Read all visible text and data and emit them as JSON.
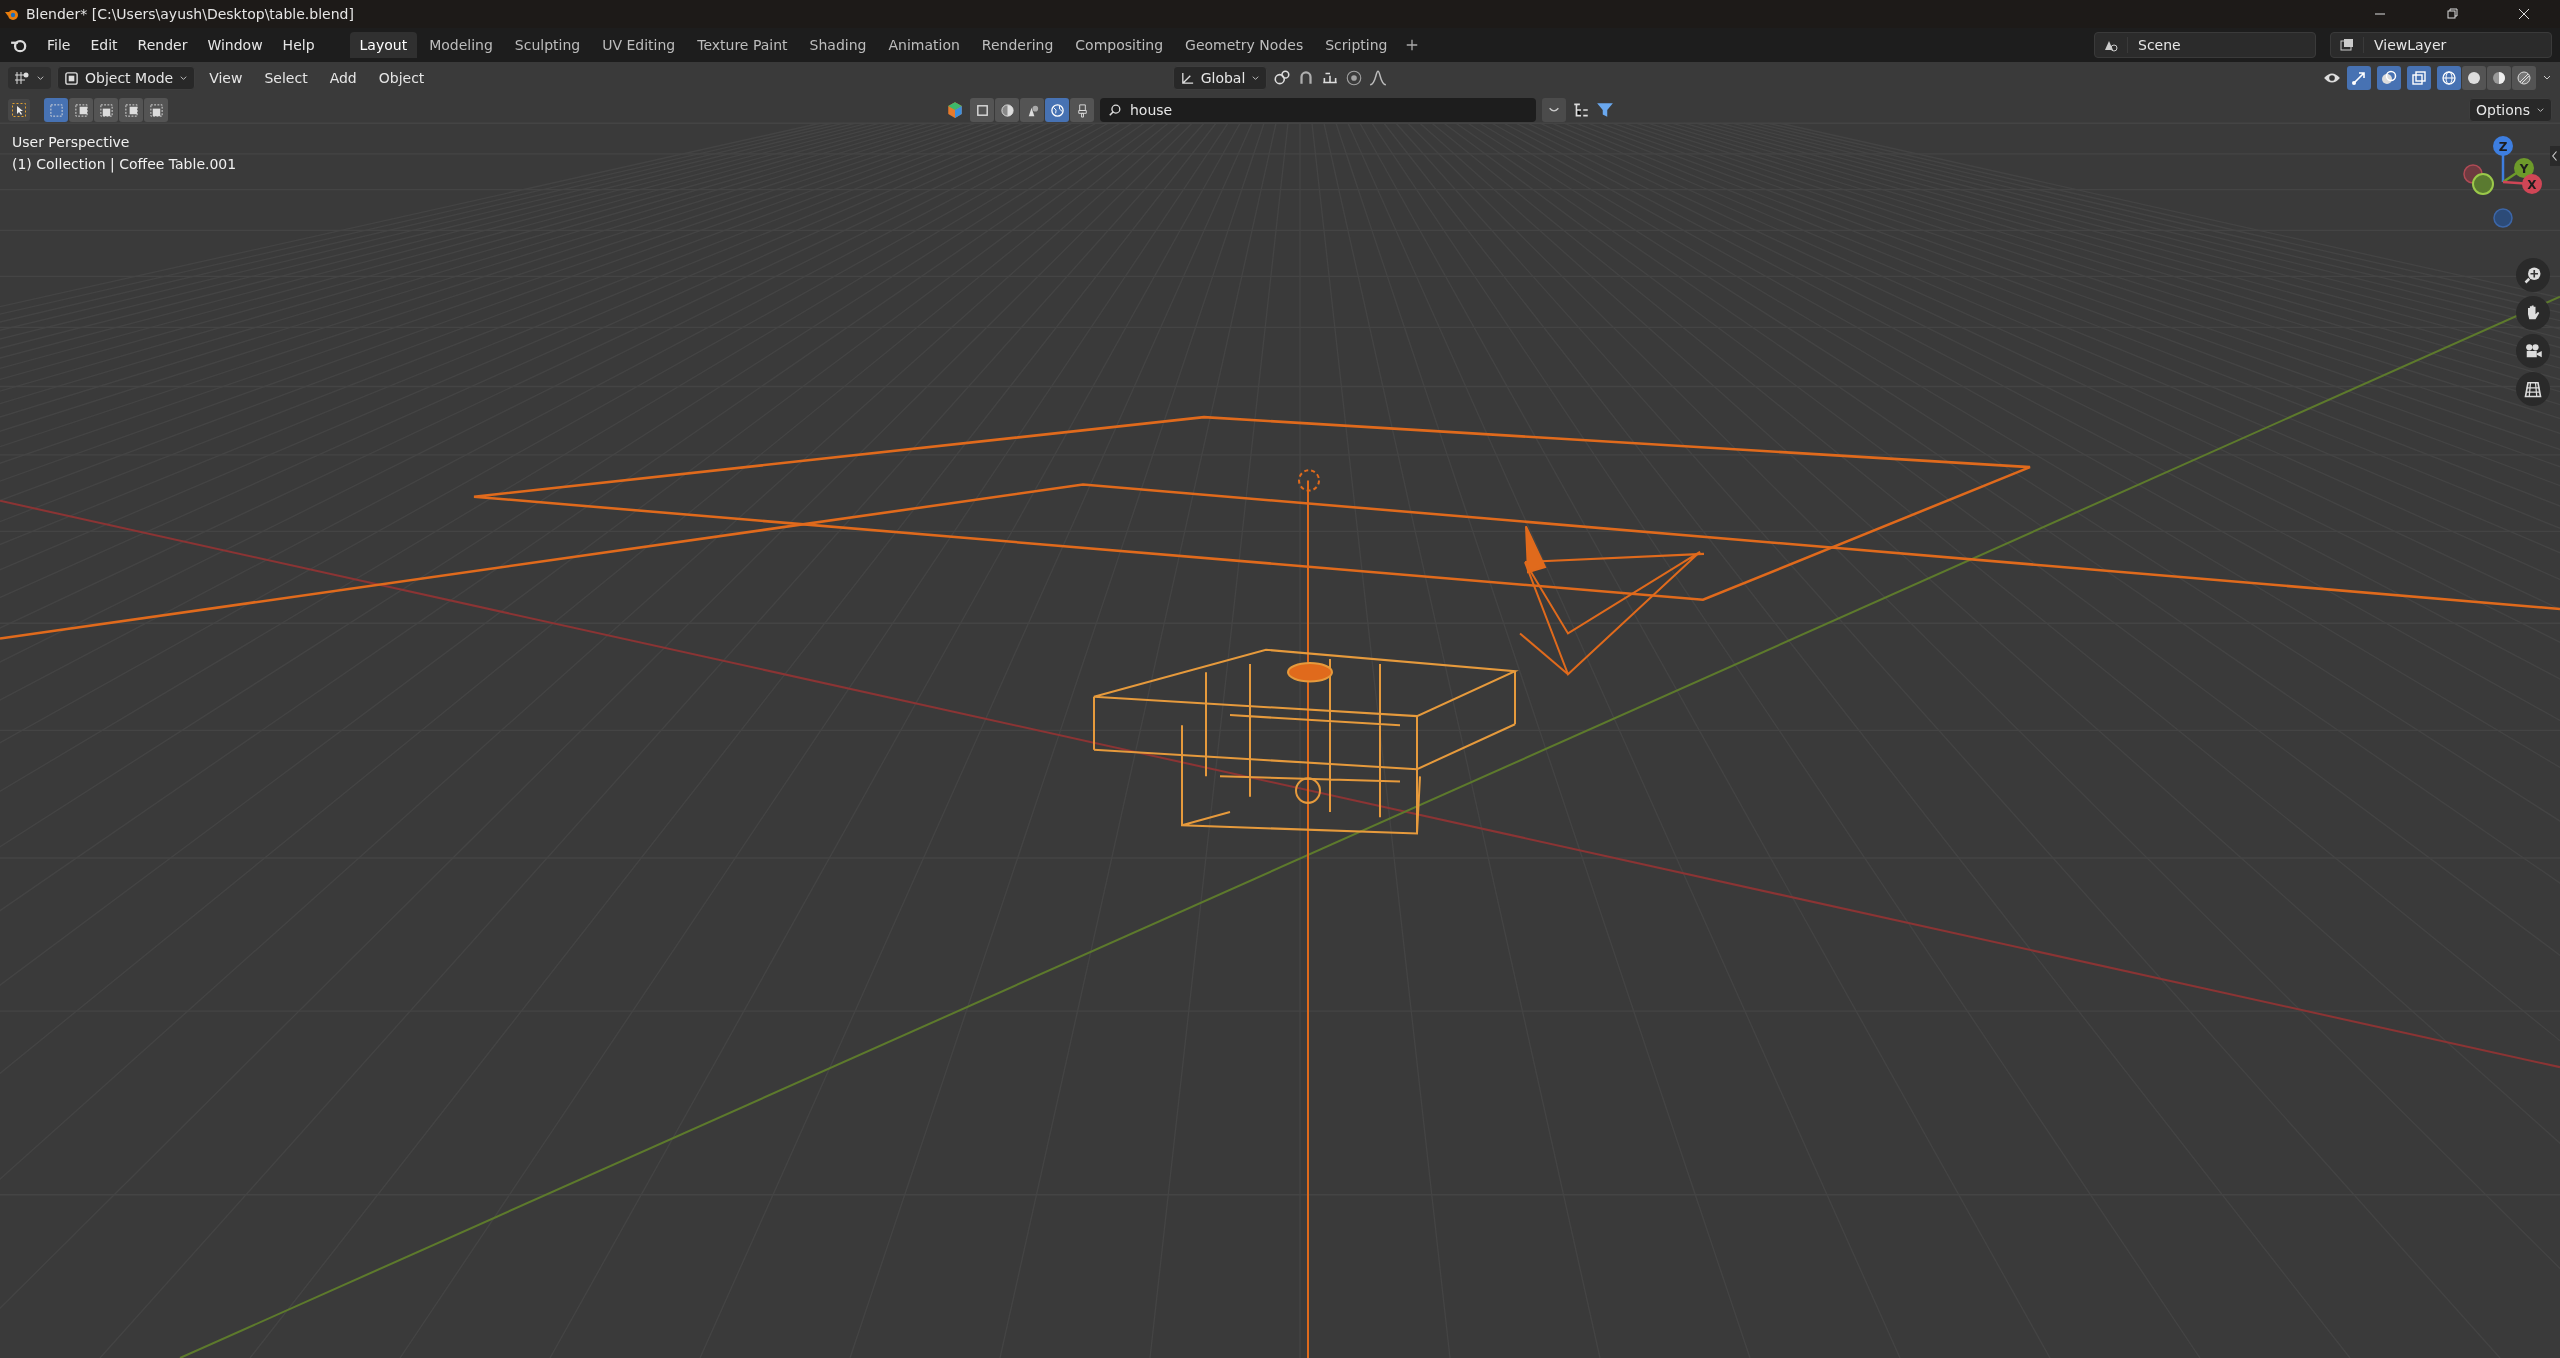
{
  "window": {
    "title": "Blender* [C:\\Users\\ayush\\Desktop\\table.blend]"
  },
  "menus": [
    "File",
    "Edit",
    "Render",
    "Window",
    "Help"
  ],
  "workspaces": [
    {
      "label": "Layout",
      "selected": true
    },
    {
      "label": "Modeling",
      "selected": false
    },
    {
      "label": "Sculpting",
      "selected": false
    },
    {
      "label": "UV Editing",
      "selected": false
    },
    {
      "label": "Texture Paint",
      "selected": false
    },
    {
      "label": "Shading",
      "selected": false
    },
    {
      "label": "Animation",
      "selected": false
    },
    {
      "label": "Rendering",
      "selected": false
    },
    {
      "label": "Compositing",
      "selected": false
    },
    {
      "label": "Geometry Nodes",
      "selected": false
    },
    {
      "label": "Scripting",
      "selected": false
    }
  ],
  "scene": {
    "value": "Scene"
  },
  "view_layer": {
    "value": "ViewLayer"
  },
  "header": {
    "mode": "Object Mode",
    "menus": [
      "View",
      "Select",
      "Add",
      "Object"
    ],
    "orientation": "Global",
    "options": "Options",
    "select_modes": [
      {
        "selected": true
      },
      {
        "selected": false
      },
      {
        "selected": false
      },
      {
        "selected": false
      },
      {
        "selected": false
      }
    ],
    "shading_modes": [
      {
        "selected": true
      },
      {
        "selected": false
      },
      {
        "selected": false
      },
      {
        "selected": false
      }
    ]
  },
  "search": {
    "value": "house"
  },
  "viewport": {
    "view_name": "User Perspective",
    "object_info": "(1) Collection | Coffee Table.001",
    "gizmo": [
      "Z",
      "Y",
      "X"
    ]
  }
}
